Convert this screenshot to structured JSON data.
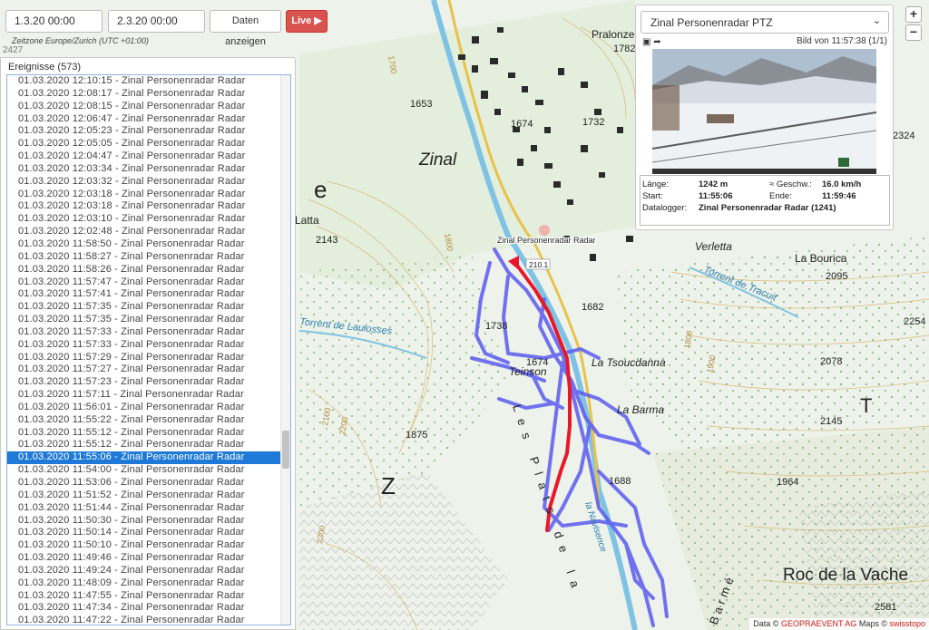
{
  "header": {
    "date_from": "1.3.20 00:00",
    "date_to": "2.3.20 00:00",
    "show_button": "Daten anzeigen",
    "live_button": "Live ▶",
    "timezone": "Zeitzone Europe/Zurich (UTC +01:00)"
  },
  "events": {
    "title": "Ereignisse (573)",
    "selected_index": 30,
    "items": [
      "01.03.2020 12:10:15 - Zinal Personenradar Radar",
      "01.03.2020 12:08:17 - Zinal Personenradar Radar",
      "01.03.2020 12:08:15 - Zinal Personenradar Radar",
      "01.03.2020 12:06:47 - Zinal Personenradar Radar",
      "01.03.2020 12:05:23 - Zinal Personenradar Radar",
      "01.03.2020 12:05:05 - Zinal Personenradar Radar",
      "01.03.2020 12:04:47 - Zinal Personenradar Radar",
      "01.03.2020 12:03:34 - Zinal Personenradar Radar",
      "01.03.2020 12:03:32 - Zinal Personenradar Radar",
      "01.03.2020 12:03:18 - Zinal Personenradar Radar",
      "01.03.2020 12:03:18 - Zinal Personenradar Radar",
      "01.03.2020 12:03:10 - Zinal Personenradar Radar",
      "01.03.2020 12:02:48 - Zinal Personenradar Radar",
      "01.03.2020 11:58:50 - Zinal Personenradar Radar",
      "01.03.2020 11:58:27 - Zinal Personenradar Radar",
      "01.03.2020 11:58:26 - Zinal Personenradar Radar",
      "01.03.2020 11:57:47 - Zinal Personenradar Radar",
      "01.03.2020 11:57:41 - Zinal Personenradar Radar",
      "01.03.2020 11:57:35 - Zinal Personenradar Radar",
      "01.03.2020 11:57:35 - Zinal Personenradar Radar",
      "01.03.2020 11:57:33 - Zinal Personenradar Radar",
      "01.03.2020 11:57:33 - Zinal Personenradar Radar",
      "01.03.2020 11:57:29 - Zinal Personenradar Radar",
      "01.03.2020 11:57:27 - Zinal Personenradar Radar",
      "01.03.2020 11:57:23 - Zinal Personenradar Radar",
      "01.03.2020 11:57:11 - Zinal Personenradar Radar",
      "01.03.2020 11:56:01 - Zinal Personenradar Radar",
      "01.03.2020 11:55:22 - Zinal Personenradar Radar",
      "01.03.2020 11:55:12 - Zinal Personenradar Radar",
      "01.03.2020 11:55:12 - Zinal Personenradar Radar",
      "01.03.2020 11:55:06 - Zinal Personenradar Radar",
      "01.03.2020 11:54:00 - Zinal Personenradar Radar",
      "01.03.2020 11:53:06 - Zinal Personenradar Radar",
      "01.03.2020 11:51:52 - Zinal Personenradar Radar",
      "01.03.2020 11:51:44 - Zinal Personenradar Radar",
      "01.03.2020 11:50:30 - Zinal Personenradar Radar",
      "01.03.2020 11:50:14 - Zinal Personenradar Radar",
      "01.03.2020 11:50:10 - Zinal Personenradar Radar",
      "01.03.2020 11:49:46 - Zinal Personenradar Radar",
      "01.03.2020 11:49:24 - Zinal Personenradar Radar",
      "01.03.2020 11:48:09 - Zinal Personenradar Radar",
      "01.03.2020 11:47:55 - Zinal Personenradar Radar",
      "01.03.2020 11:47:34 - Zinal Personenradar Radar",
      "01.03.2020 11:47:22 - Zinal Personenradar Radar"
    ]
  },
  "camera": {
    "selected": "Zinal Personenradar PTZ",
    "frame_info": "Bild von 11:57:38 (1/1)",
    "length_label": "Länge:",
    "length_value": "1242 m",
    "speed_label": "Geschw.:",
    "speed_value": "16.0 km/h",
    "start_label": "Start:",
    "start_value": "11:55:06",
    "end_label": "Ende:",
    "end_value": "11:59:46",
    "logger_label": "Datalogger:",
    "logger_value": "Zinal Personenradar Radar (1241)"
  },
  "map": {
    "radar_label": "Zinal Personenradar Radar",
    "radar_id": "210.1",
    "labels": {
      "zinal": "Zinal",
      "pralonze": "Pralonze",
      "latta": "Latta",
      "verletta": "Verletta",
      "la_bourica": "La Bourica",
      "torrent_tracuit": "Torrent de Tracuit",
      "torrent_laulosses": "Torrent de Laulosses",
      "la_tsoucdanna": "La Tsoucdanna",
      "la_barma": "La Barma",
      "teinson": "Teinson",
      "les_plats_de_la": "Les Plats de la",
      "la_navisence": "la Navisence",
      "roc_de_la_vache": "Roc de la Vache",
      "barme": "Barmé",
      "letter_e": "e",
      "letter_z": "Z",
      "letter_t": "T",
      "elev_1653": "1653",
      "elev_1674a": "1674",
      "elev_1732": "1732",
      "elev_1782": "1782",
      "elev_2324": "2324",
      "elev_2143": "2143",
      "elev_1738": "1738",
      "elev_1674b": "1674",
      "elev_1682": "1682",
      "elev_2095": "2095",
      "elev_2254": "2254",
      "elev_2078": "2078",
      "elev_2145": "2145",
      "elev_1875": "1875",
      "elev_1688": "1688",
      "elev_1964": "1964",
      "elev_2581": "2581",
      "elev_2427": "2427",
      "contour_1700": "1700",
      "contour_1800a": "1800",
      "contour_1800b": "1800",
      "contour_1900": "1900",
      "contour_2000": "2000",
      "contour_2100": "2100",
      "contour_2200": "2200",
      "contour_2300": "2300"
    },
    "track_color": "#e8182a",
    "other_tracks_color": "#5b5bf0"
  },
  "zoom": {
    "in": "+",
    "out": "−"
  },
  "attribution": {
    "prefix": "Data ©",
    "provider": "GEOPRAEVENT AG",
    "maps": "Maps ©",
    "maps_provider": "swisstopo"
  }
}
